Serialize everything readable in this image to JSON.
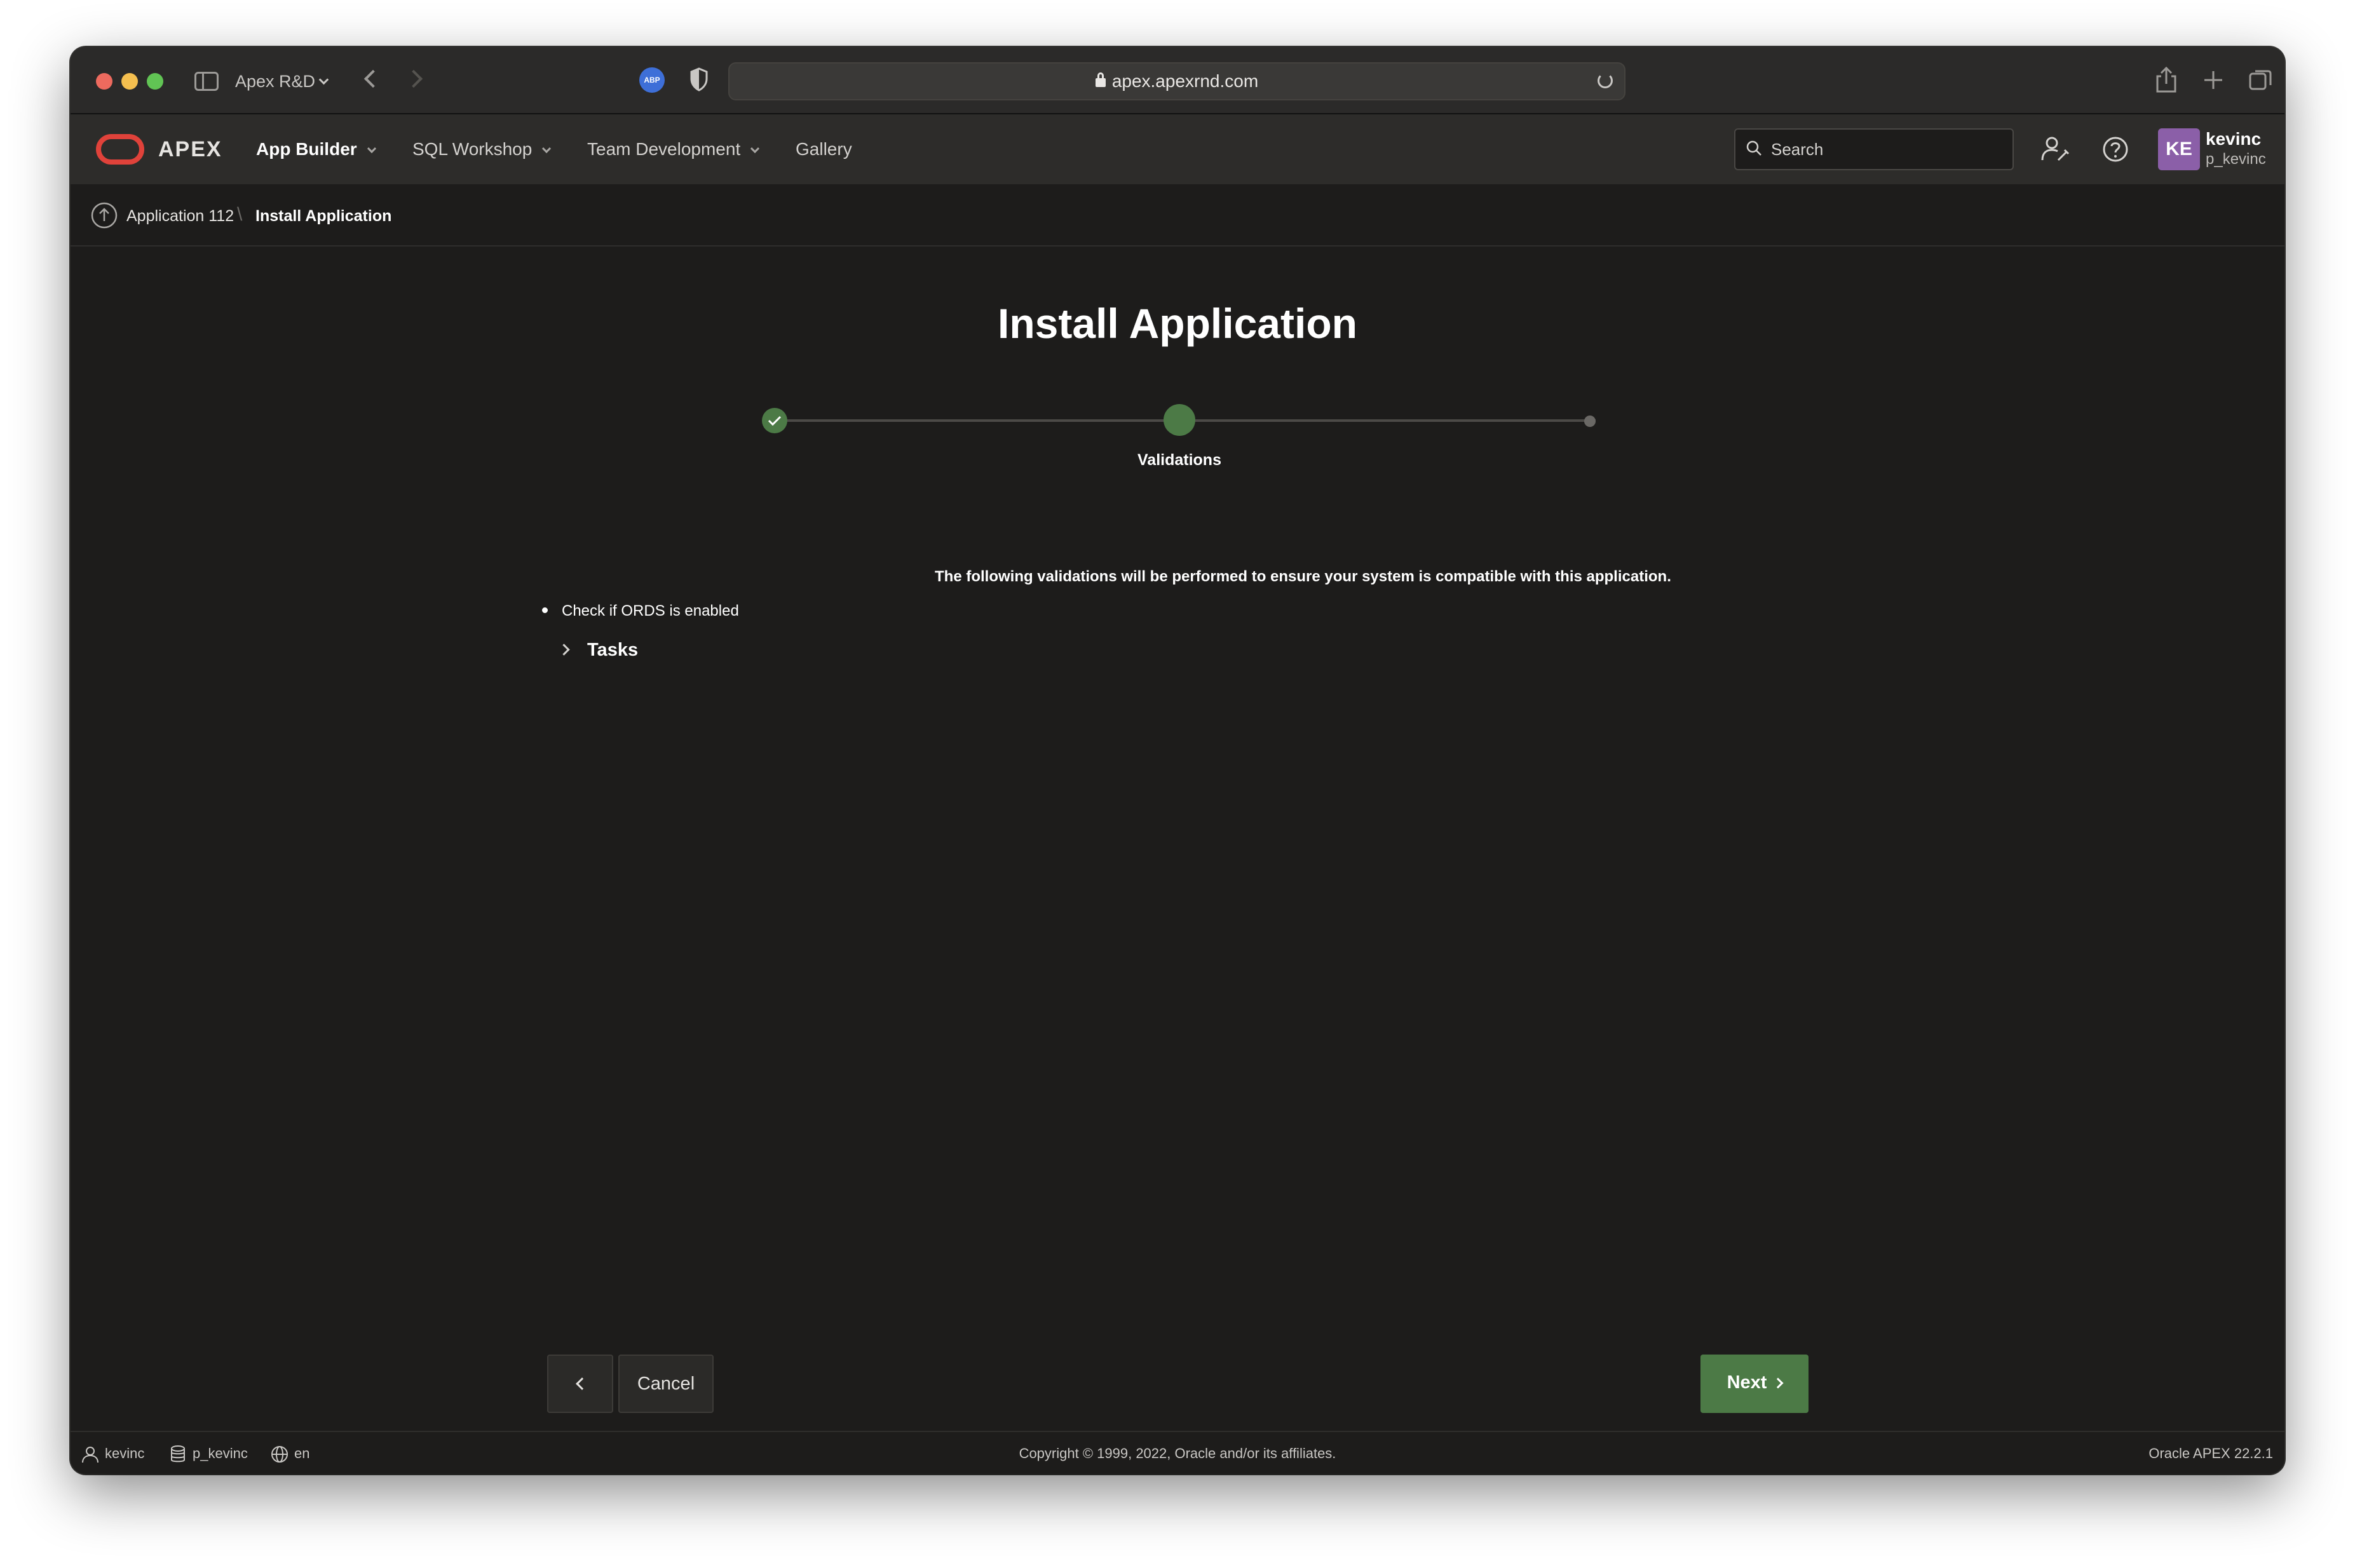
{
  "browser": {
    "tab_group": "Apex R&D",
    "url": "apex.apexrnd.com",
    "extension_label": "ABP"
  },
  "header": {
    "brand": "APEX",
    "menu": [
      {
        "label": "App Builder"
      },
      {
        "label": "SQL Workshop"
      },
      {
        "label": "Team Development"
      },
      {
        "label": "Gallery"
      }
    ],
    "search_placeholder": "Search",
    "user": {
      "initials": "KE",
      "name": "kevinc",
      "workspace": "p_kevinc"
    }
  },
  "breadcrumb": {
    "parent": "Application 112",
    "current": "Install Application"
  },
  "main": {
    "title": "Install Application",
    "steps": {
      "current_label": "Validations"
    },
    "intro": "The following validations will be performed to ensure your system is compatible with this application.",
    "validations": [
      "Check if ORDS is enabled"
    ],
    "tasks_label": "Tasks"
  },
  "buttons": {
    "cancel": "Cancel",
    "next": "Next"
  },
  "footer": {
    "user": "kevinc",
    "workspace": "p_kevinc",
    "language": "en",
    "copyright": "Copyright © 1999, 2022, Oracle and/or its affiliates.",
    "version": "Oracle APEX 22.2.1"
  },
  "colors": {
    "accent_green": "#4c7a46",
    "oracle_red": "#e0423a",
    "avatar_purple": "#8b5fa8"
  }
}
